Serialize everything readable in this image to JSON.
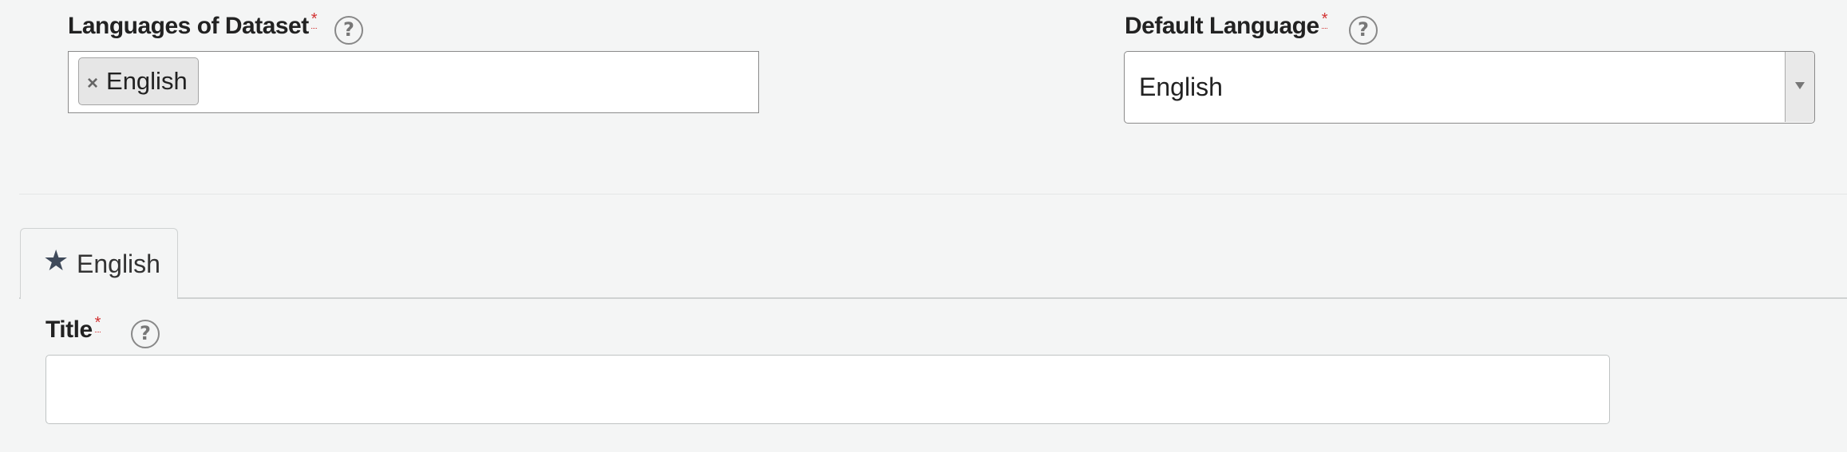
{
  "languages_field": {
    "label": "Languages of Dataset",
    "required_mark": "*",
    "help_glyph": "?",
    "selected_tags": [
      {
        "remove_glyph": "×",
        "label": "English"
      }
    ]
  },
  "default_language_field": {
    "label": "Default Language",
    "required_mark": "*",
    "help_glyph": "?",
    "selected_value": "English",
    "options": [
      "English"
    ]
  },
  "language_tabs": [
    {
      "icon": "star-icon",
      "star_glyph": "★",
      "label": "English",
      "active": true
    }
  ],
  "title_field": {
    "label": "Title",
    "required_mark": "*",
    "help_glyph": "?",
    "value": ""
  },
  "colors": {
    "background": "#f4f5f5",
    "required_asterisk": "#d23232",
    "star": "#3f4a5a"
  }
}
